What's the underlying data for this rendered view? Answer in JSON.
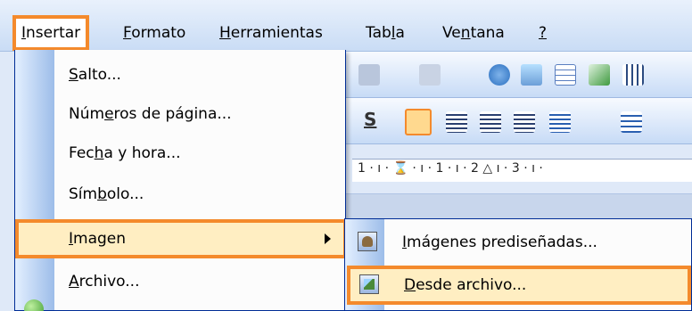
{
  "menubar": {
    "items": [
      {
        "pre": "",
        "u": "I",
        "post": "nsertar"
      },
      {
        "pre": "",
        "u": "F",
        "post": "ormato"
      },
      {
        "pre": "",
        "u": "H",
        "post": "erramientas"
      },
      {
        "pre": "Tab",
        "u": "l",
        "post": "a"
      },
      {
        "pre": "Ve",
        "u": "n",
        "post": "tana"
      },
      {
        "pre": "",
        "u": "?",
        "post": ""
      }
    ]
  },
  "dropdown": {
    "items": [
      {
        "pre": "",
        "u": "S",
        "post": "alto..."
      },
      {
        "pre": "Núm",
        "u": "e",
        "post": "ros de página..."
      },
      {
        "pre": "Fec",
        "u": "h",
        "post": "a y hora..."
      },
      {
        "pre": "Sím",
        "u": "b",
        "post": "olo..."
      },
      {
        "pre": "",
        "u": "I",
        "post": "magen"
      },
      {
        "pre": "",
        "u": "A",
        "post": "rchivo..."
      }
    ]
  },
  "submenu": {
    "items": [
      {
        "pre": "",
        "u": "I",
        "post": "mágenes prediseñadas..."
      },
      {
        "pre": "",
        "u": "D",
        "post": "esde archivo..."
      }
    ]
  },
  "toolbar": {
    "underline_s": "S",
    "ruler_text": "1 · ı · ⌛ · ı · 1 · ı · 2 △ ı · 3 · ı ·",
    "icons": [
      "undo-icon",
      "redo-icon",
      "hyperlink-icon",
      "drawing-icon",
      "table-icon",
      "excel-icon",
      "columns-icon",
      "align-left-icon",
      "align-center-icon",
      "align-right-icon",
      "justify-icon",
      "line-spacing-icon",
      "numbering-icon"
    ]
  },
  "colors": {
    "highlight_border": "#f48a2c",
    "highlight_fill": "#ffeec2",
    "menu_border": "#002d96"
  }
}
